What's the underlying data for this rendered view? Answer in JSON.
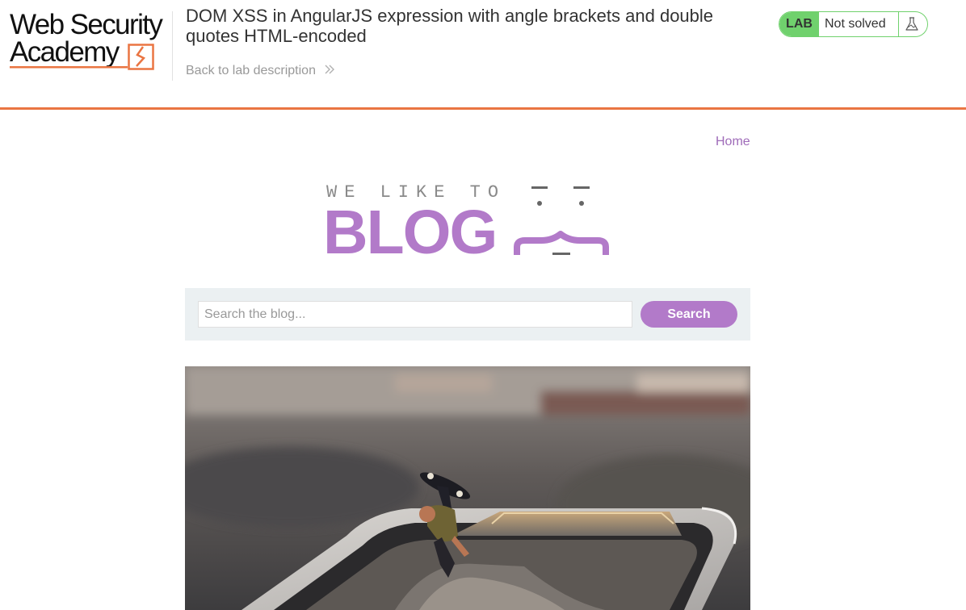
{
  "header": {
    "logo_line1": "Web Security",
    "logo_line2": "Academy",
    "lab_title": "DOM XSS in AngularJS expression with angle brackets and double quotes HTML-encoded",
    "back_link": "Back to lab description",
    "lab_badge": "LAB",
    "lab_status": "Not solved",
    "accent_color": "#ea7542",
    "status_color": "#70d16d",
    "icons": [
      "chevron-right-double-icon",
      "flask-icon"
    ]
  },
  "nav": {
    "home": "Home"
  },
  "banner": {
    "small_text": "WE LIKE TO",
    "big_text": "BLOG",
    "brand_color": "#b27ac9"
  },
  "search": {
    "placeholder": "Search the blog...",
    "value": "",
    "button_label": "Search"
  },
  "post": {
    "image_description_icon": "blog-post-image"
  }
}
